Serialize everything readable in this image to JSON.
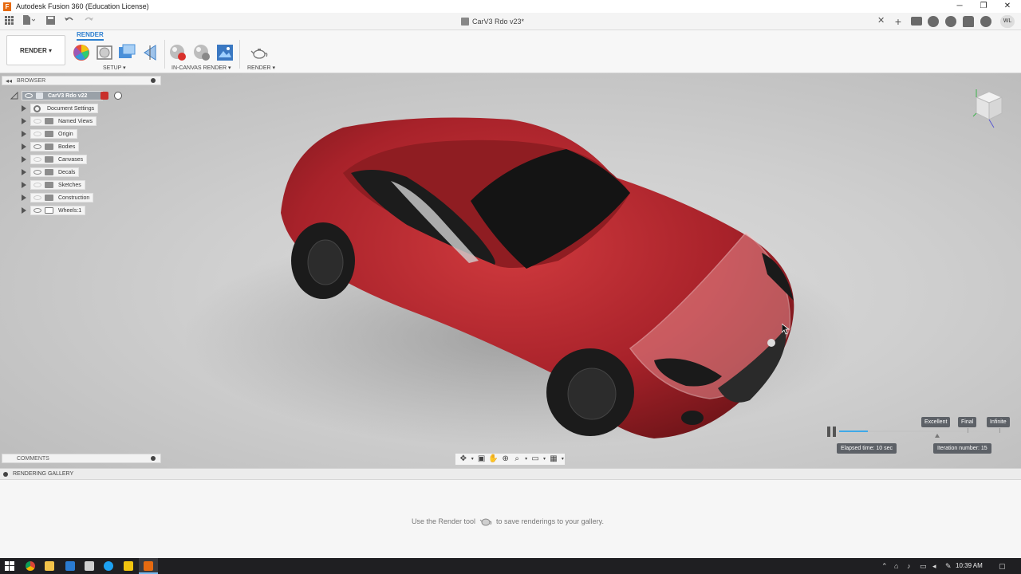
{
  "window": {
    "title": "Autodesk Fusion 360 (Education License)",
    "minimize": "─",
    "maximize": "❐",
    "close": "✕"
  },
  "toolstrip": {
    "grid_icon": "app-grid-icon",
    "file_icon": "file-icon",
    "save_icon": "save-icon",
    "undo_icon": "undo-icon",
    "redo_icon": "redo-icon",
    "document_tab": "CarV3 Rdo v23*",
    "tab_close": "✕",
    "user_initials": "WL"
  },
  "ribbon": {
    "active_tab": "RENDER",
    "workspace_switcher": "RENDER ▾",
    "groups": {
      "setup": "SETUP ▾",
      "in_canvas_render": "IN-CANVAS RENDER ▾",
      "render": "RENDER ▾"
    }
  },
  "browser": {
    "title": "BROWSER",
    "root": "CarV3 Rdo v22",
    "items": [
      {
        "label": "Document Settings",
        "kind": "gear",
        "visible": false
      },
      {
        "label": "Named Views",
        "kind": "folder",
        "visible": false
      },
      {
        "label": "Origin",
        "kind": "folder",
        "visible": false
      },
      {
        "label": "Bodies",
        "kind": "folder",
        "visible": true
      },
      {
        "label": "Canvases",
        "kind": "folder",
        "visible": false
      },
      {
        "label": "Decals",
        "kind": "folder",
        "visible": true
      },
      {
        "label": "Sketches",
        "kind": "folder",
        "visible": false
      },
      {
        "label": "Construction",
        "kind": "folder",
        "visible": false
      },
      {
        "label": "Wheels:1",
        "kind": "component",
        "visible": true
      }
    ]
  },
  "comments": {
    "title": "COMMENTS"
  },
  "render_progress": {
    "quality_excellent": "Excellent",
    "quality_final": "Final",
    "quality_infinite": "Infinite",
    "elapsed": "Elapsed time: 10 sec",
    "iteration": "Iteration number: 15",
    "progress_fraction": 0.18
  },
  "gallery": {
    "title": "RENDERING GALLERY",
    "message_before": "Use the Render tool",
    "message_after": "to save renderings to your gallery."
  },
  "taskbar": {
    "clock": "10:39 AM"
  },
  "colors": {
    "accent": "#2d7fd0",
    "car_body": "#b3262b",
    "progress": "#3fa9e8"
  }
}
